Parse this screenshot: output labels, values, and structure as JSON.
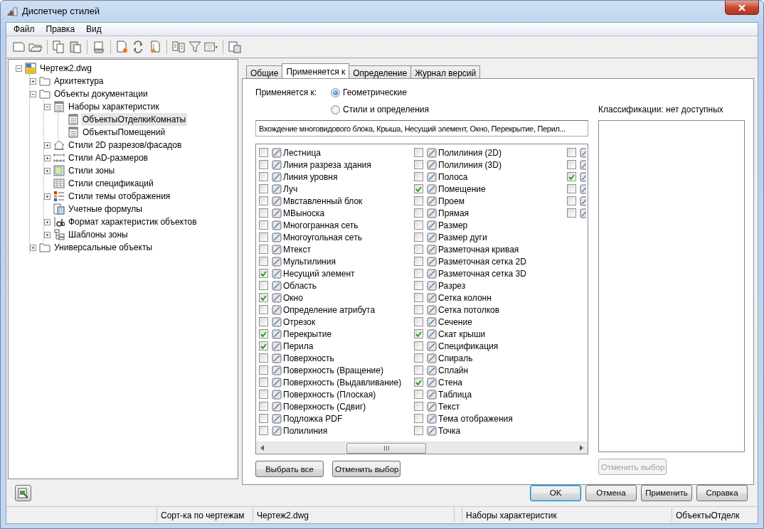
{
  "window": {
    "title": "Диспетчер стилей"
  },
  "menu": [
    "Файл",
    "Правка",
    "Вид"
  ],
  "tree": [
    {
      "label": "Чертеж2.dwg",
      "kind": "drawing",
      "expanded": true,
      "selected": false,
      "children": [
        {
          "label": "Архитектура",
          "kind": "folder",
          "expanded": false,
          "selected": false
        },
        {
          "label": "Объекты документации",
          "kind": "folder",
          "expanded": true,
          "selected": false,
          "children": [
            {
              "label": "Наборы характеристик",
              "kind": "list",
              "expanded": true,
              "selected": false,
              "children": [
                {
                  "label": "ОбъектыОтделкиКомнаты",
                  "kind": "list",
                  "selected": true
                },
                {
                  "label": "ОбъектыПомещений",
                  "kind": "list",
                  "selected": false
                }
              ]
            },
            {
              "label": "Стили 2D разрезов/фасадов",
              "kind": "house",
              "expanded": false,
              "selected": false
            },
            {
              "label": "Стили AD-размеров",
              "kind": "dims",
              "expanded": false,
              "selected": false
            },
            {
              "label": "Стили зоны",
              "kind": "zone",
              "expanded": false,
              "selected": false
            },
            {
              "label": "Стили спецификаций",
              "kind": "table",
              "selected": false
            },
            {
              "label": "Стили темы отображения",
              "kind": "legend",
              "expanded": false,
              "selected": false
            },
            {
              "label": "Учетные формулы",
              "kind": "calc",
              "selected": false
            },
            {
              "label": "Формат характеристик объектов",
              "kind": "format",
              "expanded": false,
              "selected": false
            },
            {
              "label": "Шаблоны зоны",
              "kind": "outline",
              "expanded": false,
              "selected": false
            }
          ]
        },
        {
          "label": "Универсальные объекты",
          "kind": "folder",
          "expanded": false,
          "selected": false
        }
      ]
    }
  ],
  "tabs": [
    {
      "label": "Общие",
      "selected": false
    },
    {
      "label": "Применяется к",
      "selected": true
    },
    {
      "label": "Определение",
      "selected": false
    },
    {
      "label": "Журнал версий",
      "selected": false
    }
  ],
  "applies_to": {
    "label": "Применяется к:",
    "options": [
      {
        "label": "Геометрические",
        "selected": true
      },
      {
        "label": "Стили и определения",
        "selected": false
      }
    ]
  },
  "summary_field": {
    "value": "Вхождение многовидового блока, Крыша, Несущий элемент, Окно, Перекрытие, Перил..."
  },
  "object_columns": [
    [
      {
        "label": "Лестница",
        "checked": false
      },
      {
        "label": "Линия разреза здания",
        "checked": false
      },
      {
        "label": "Линия уровня",
        "checked": false
      },
      {
        "label": "Луч",
        "checked": false
      },
      {
        "label": "Мвставленный блок",
        "checked": false
      },
      {
        "label": "МВыноска",
        "checked": false
      },
      {
        "label": "Многогранная сеть",
        "checked": false
      },
      {
        "label": "Многоугольная сеть",
        "checked": false
      },
      {
        "label": "Мтекст",
        "checked": false
      },
      {
        "label": "Мультилиния",
        "checked": false
      },
      {
        "label": "Несущий элемент",
        "checked": true
      },
      {
        "label": "Область",
        "checked": false
      },
      {
        "label": "Окно",
        "checked": true
      },
      {
        "label": "Определение атрибута",
        "checked": false
      },
      {
        "label": "Отрезок",
        "checked": false
      },
      {
        "label": "Перекрытие",
        "checked": true
      },
      {
        "label": "Перила",
        "checked": true
      },
      {
        "label": "Поверхность",
        "checked": false
      },
      {
        "label": "Поверхность (Вращение)",
        "checked": false
      },
      {
        "label": "Поверхность (Выдавливание)",
        "checked": false
      },
      {
        "label": "Поверхность (Плоская)",
        "checked": false
      },
      {
        "label": "Поверхность (Сдвиг)",
        "checked": false
      },
      {
        "label": "Подложка PDF",
        "checked": false
      },
      {
        "label": "Полилиния",
        "checked": false
      }
    ],
    [
      {
        "label": "Полилиния (2D)",
        "checked": false
      },
      {
        "label": "Полилиния (3D)",
        "checked": false
      },
      {
        "label": "Полоса",
        "checked": false
      },
      {
        "label": "Помещение",
        "checked": true
      },
      {
        "label": "Проем",
        "checked": false
      },
      {
        "label": "Прямая",
        "checked": false
      },
      {
        "label": "Размер",
        "checked": false
      },
      {
        "label": "Размер дуги",
        "checked": false
      },
      {
        "label": "Разметочная кривая",
        "checked": false
      },
      {
        "label": "Разметочная сетка 2D",
        "checked": false
      },
      {
        "label": "Разметочная сетка 3D",
        "checked": false
      },
      {
        "label": "Разрез",
        "checked": false
      },
      {
        "label": "Сетка колонн",
        "checked": false
      },
      {
        "label": "Сетка потолков",
        "checked": false
      },
      {
        "label": "Сечение",
        "checked": false
      },
      {
        "label": "Скат крыши",
        "checked": true
      },
      {
        "label": "Спецификация",
        "checked": false
      },
      {
        "label": "Спираль",
        "checked": false
      },
      {
        "label": "Сплайн",
        "checked": false
      },
      {
        "label": "Стена",
        "checked": true
      },
      {
        "label": "Таблица",
        "checked": false
      },
      {
        "label": "Текст",
        "checked": false
      },
      {
        "label": "Тема отображения",
        "checked": false
      },
      {
        "label": "Точка",
        "checked": false
      }
    ],
    [
      {
        "checked": false
      },
      {
        "checked": false
      },
      {
        "checked": true
      },
      {
        "checked": false
      },
      {
        "checked": false
      },
      {
        "checked": false
      }
    ]
  ],
  "list_buttons": [
    "Выбрать все",
    "Отменить выбор"
  ],
  "classifications": {
    "label": "Классификации: нет доступных",
    "button": {
      "label": "Отменить выбор",
      "disabled": true
    }
  },
  "dialog_buttons": [
    {
      "label": "OK",
      "default": true
    },
    {
      "label": "Отмена",
      "default": false
    },
    {
      "label": "Применить",
      "default": false
    },
    {
      "label": "Справка",
      "default": false
    }
  ],
  "status_bar": [
    "Сорт-ка по чертежам",
    "Чертеж2.dwg",
    "Наборы характеристик",
    "ОбъектыОтделк"
  ]
}
